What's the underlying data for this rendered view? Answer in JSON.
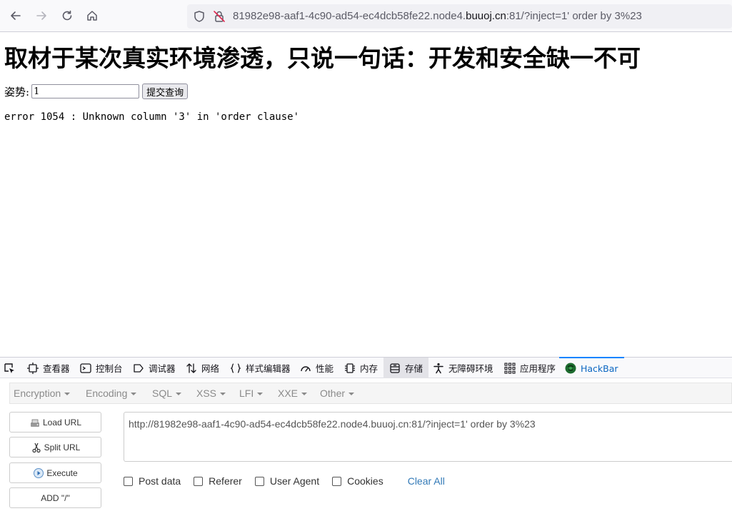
{
  "browser": {
    "url_prefix": "81982e98-aaf1-4c90-ad54-ec4dcb58fe22.node4.",
    "url_domain": "buuoj.cn",
    "url_suffix": ":81/?inject=1' order by 3%23"
  },
  "page": {
    "heading": "取材于某次真实环境渗透，只说一句话：开发和安全缺一不可",
    "input_label": "姿势:",
    "input_value": "1",
    "submit_label": "提交查询",
    "error_message": "error 1054 : Unknown column '3' in 'order clause'"
  },
  "devtools": {
    "tabs": [
      {
        "label": "查看器",
        "icon": "inspector-icon"
      },
      {
        "label": "控制台",
        "icon": "console-icon"
      },
      {
        "label": "调试器",
        "icon": "debugger-icon"
      },
      {
        "label": "网络",
        "icon": "network-icon"
      },
      {
        "label": "样式编辑器",
        "icon": "style-editor-icon"
      },
      {
        "label": "性能",
        "icon": "performance-icon"
      },
      {
        "label": "内存",
        "icon": "memory-icon"
      },
      {
        "label": "存储",
        "icon": "storage-icon"
      },
      {
        "label": "无障碍环境",
        "icon": "accessibility-icon"
      },
      {
        "label": "应用程序",
        "icon": "application-icon"
      },
      {
        "label": "HackBar",
        "icon": "hackbar-icon"
      }
    ],
    "active_tab": "HackBar",
    "accent_color": "#0a84ff"
  },
  "hackbar": {
    "menu": [
      "Encryption",
      "Encoding",
      "SQL",
      "XSS",
      "LFI",
      "XXE",
      "Other"
    ],
    "buttons": {
      "load_url": "Load URL",
      "split_url": "Split URL",
      "execute": "Execute",
      "add_slash": "ADD \"/\""
    },
    "url_value": "http://81982e98-aaf1-4c90-ad54-ec4dcb58fe22.node4.buuoj.cn:81/?inject=1' order by 3%23",
    "options": {
      "post_data": "Post data",
      "referer": "Referer",
      "user_agent": "User Agent",
      "cookies": "Cookies"
    },
    "clear_all": "Clear All"
  }
}
